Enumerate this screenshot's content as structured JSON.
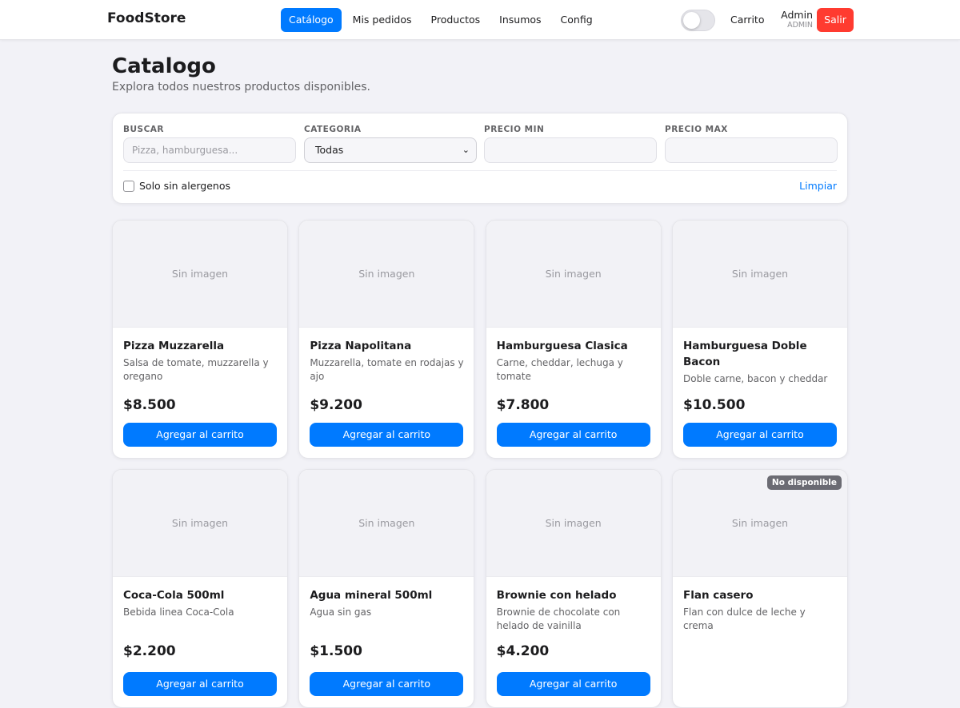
{
  "app": {
    "brand": "FoodStore"
  },
  "nav": {
    "links": [
      {
        "label": "Catálogo",
        "active": true
      },
      {
        "label": "Mis pedidos",
        "active": false
      },
      {
        "label": "Productos",
        "active": false
      },
      {
        "label": "Insumos",
        "active": false
      },
      {
        "label": "Config",
        "active": false
      }
    ],
    "theme_toggle_icon": "toggle-switch-icon",
    "cart_label": "Carrito",
    "user_name": "Admin",
    "user_role": "ADMIN",
    "logout_label": "Salir",
    "accent_color": "#007aff",
    "danger_color": "#ff3b30"
  },
  "page": {
    "title": "Catalogo",
    "subtitle": "Explora todos nuestros productos disponibles."
  },
  "filters": {
    "search_label": "BUSCAR",
    "search_placeholder": "Pizza, hamburguesa...",
    "search_value": "",
    "category_label": "CATEGORIA",
    "category_value": "Todas",
    "category_chevron_icon": "chevron-down-icon",
    "price_min_label": "PRECIO MIN",
    "price_min_value": "",
    "price_max_label": "PRECIO MAX",
    "price_max_value": "",
    "allergen_checkbox_label": "Solo sin alergenos",
    "allergen_checked": false,
    "clear_label": "Limpiar"
  },
  "products": [
    {
      "name": "Pizza Muzzarella",
      "desc": "Salsa de tomate, muzzarella y oregano",
      "price": "$8.500",
      "image_text": "Sin imagen",
      "button": "Agregar al carrito",
      "badge": ""
    },
    {
      "name": "Pizza Napolitana",
      "desc": "Muzzarella, tomate en rodajas y ajo",
      "price": "$9.200",
      "image_text": "Sin imagen",
      "button": "Agregar al carrito",
      "badge": ""
    },
    {
      "name": "Hamburguesa Clasica",
      "desc": "Carne, cheddar, lechuga y tomate",
      "price": "$7.800",
      "image_text": "Sin imagen",
      "button": "Agregar al carrito",
      "badge": ""
    },
    {
      "name": "Hamburguesa Doble Bacon",
      "desc": "Doble carne, bacon y cheddar",
      "price": "$10.500",
      "image_text": "Sin imagen",
      "button": "Agregar al carrito",
      "badge": ""
    },
    {
      "name": "Coca-Cola 500ml",
      "desc": "Bebida linea Coca-Cola",
      "price": "$2.200",
      "image_text": "Sin imagen",
      "button": "Agregar al carrito",
      "badge": ""
    },
    {
      "name": "Agua mineral 500ml",
      "desc": "Agua sin gas",
      "price": "$1.500",
      "image_text": "Sin imagen",
      "button": "Agregar al carrito",
      "badge": ""
    },
    {
      "name": "Brownie con helado",
      "desc": "Brownie de chocolate con helado de vainilla",
      "price": "$4.200",
      "image_text": "Sin imagen",
      "button": "Agregar al carrito",
      "badge": ""
    },
    {
      "name": "Flan casero",
      "desc": "Flan con dulce de leche y crema",
      "price": "",
      "image_text": "Sin imagen",
      "button": "",
      "badge": "No disponible"
    }
  ]
}
